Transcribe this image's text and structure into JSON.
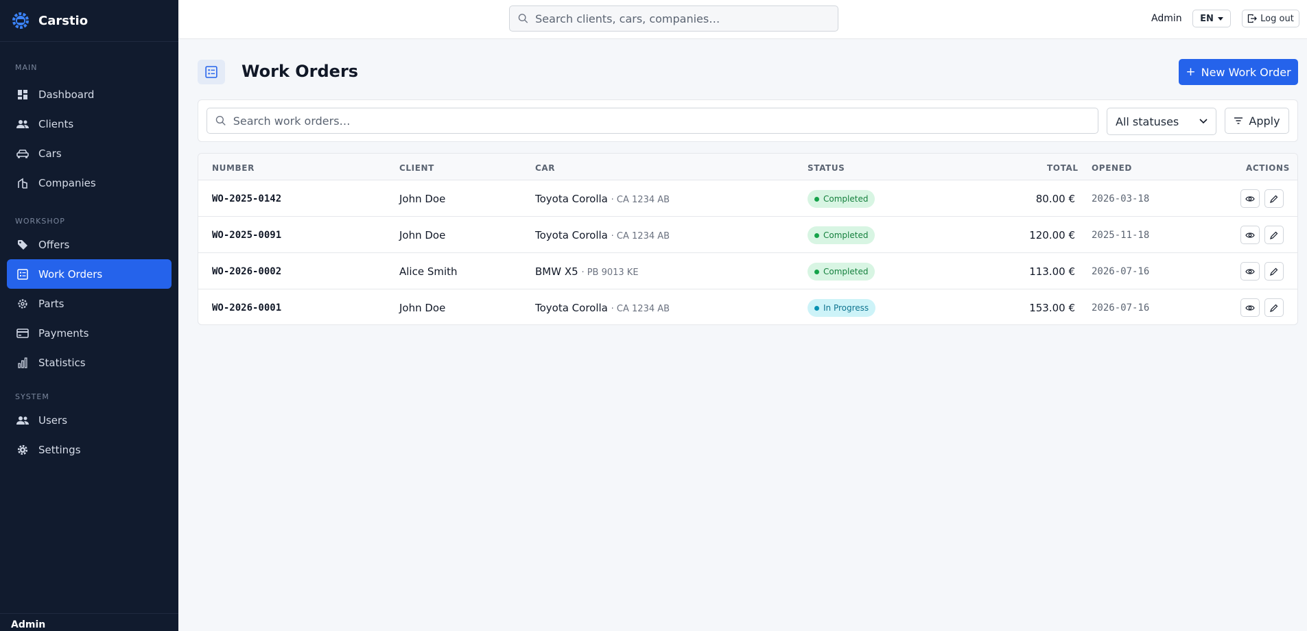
{
  "app": {
    "name": "Carstio",
    "user": "Admin",
    "language": "EN",
    "logout_label": "Log out"
  },
  "search": {
    "placeholder": "Search clients, cars, companies…"
  },
  "sidebar": {
    "sections": [
      {
        "title": "MAIN",
        "items": [
          {
            "label": "Dashboard",
            "icon": "dashboard-icon"
          },
          {
            "label": "Clients",
            "icon": "users-icon"
          },
          {
            "label": "Cars",
            "icon": "car-icon"
          },
          {
            "label": "Companies",
            "icon": "building-icon"
          }
        ]
      },
      {
        "title": "WORKSHOP",
        "items": [
          {
            "label": "Offers",
            "icon": "tag-icon"
          },
          {
            "label": "Work Orders",
            "icon": "list-icon",
            "active": true
          },
          {
            "label": "Parts",
            "icon": "gear-icon"
          },
          {
            "label": "Payments",
            "icon": "credit-card-icon"
          },
          {
            "label": "Statistics",
            "icon": "bar-chart-icon"
          }
        ]
      },
      {
        "title": "SYSTEM",
        "items": [
          {
            "label": "Users",
            "icon": "users-icon"
          },
          {
            "label": "Settings",
            "icon": "cog-icon"
          }
        ]
      }
    ],
    "footer_user": "Admin"
  },
  "page": {
    "title": "Work Orders",
    "new_button": "New Work Order",
    "search_placeholder": "Search work orders…",
    "status_filter": "All statuses",
    "apply_label": "Apply"
  },
  "table": {
    "columns": {
      "number": "NUMBER",
      "client": "CLIENT",
      "car": "CAR",
      "status": "STATUS",
      "total": "TOTAL",
      "opened": "OPENED",
      "actions": "ACTIONS"
    },
    "rows": [
      {
        "number": "WO-2025-0142",
        "client": "John Doe",
        "car": "Toyota Corolla",
        "plate": "· CA 1234 AB",
        "status": "Completed",
        "total": "80.00 €",
        "opened": "2026-03-18"
      },
      {
        "number": "WO-2025-0091",
        "client": "John Doe",
        "car": "Toyota Corolla",
        "plate": "· CA 1234 AB",
        "status": "Completed",
        "total": "120.00 €",
        "opened": "2025-11-18"
      },
      {
        "number": "WO-2026-0002",
        "client": "Alice Smith",
        "car": "BMW X5",
        "plate": "· PB 9013 KE",
        "status": "Completed",
        "total": "113.00 €",
        "opened": "2026-07-16"
      },
      {
        "number": "WO-2026-0001",
        "client": "John Doe",
        "car": "Toyota Corolla",
        "plate": "· CA 1234 AB",
        "status": "In Progress",
        "total": "153.00 €",
        "opened": "2026-07-16"
      }
    ]
  },
  "colors": {
    "accent": "#2563eb",
    "sidebar_bg": "#111b2e",
    "completed": "#16a34a",
    "in_progress": "#0891b2"
  }
}
